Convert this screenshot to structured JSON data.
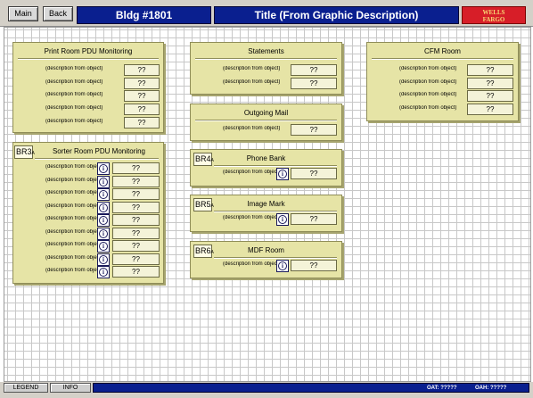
{
  "header": {
    "main_label": "Main",
    "back_label": "Back",
    "building": "Bldg #1801",
    "title": "Title (From Graphic Description)",
    "logo_line1": "WELLS",
    "logo_line2": "FARGO"
  },
  "panels": {
    "print_room": {
      "title": "Print Room PDU Monitoring",
      "rows": [
        {
          "desc": "(description from object)",
          "value": "??"
        },
        {
          "desc": "(description from object)",
          "value": "??"
        },
        {
          "desc": "(description from object)",
          "value": "??"
        },
        {
          "desc": "(description from object)",
          "value": "??"
        },
        {
          "desc": "(description from object)",
          "value": "??"
        }
      ]
    },
    "sorter_room": {
      "tag": "BR3",
      "tag_sub": "A",
      "title": "Sorter Room PDU Monitoring",
      "rows": [
        {
          "desc": "(description from object)",
          "value": "??"
        },
        {
          "desc": "(description from object)",
          "value": "??"
        },
        {
          "desc": "(description from object)",
          "value": "??"
        },
        {
          "desc": "(description from object)",
          "value": "??"
        },
        {
          "desc": "(description from object)",
          "value": "??"
        },
        {
          "desc": "(description from object)",
          "value": "??"
        },
        {
          "desc": "(description from object)",
          "value": "??"
        },
        {
          "desc": "(description from object)",
          "value": "??"
        },
        {
          "desc": "(description from object)",
          "value": "??"
        }
      ]
    },
    "statements": {
      "title": "Statements",
      "rows": [
        {
          "desc": "(description from object)",
          "value": "??"
        },
        {
          "desc": "(description from object)",
          "value": "??"
        }
      ]
    },
    "outgoing_mail": {
      "title": "Outgoing Mail",
      "rows": [
        {
          "desc": "(description from object)",
          "value": "??"
        }
      ]
    },
    "phone_bank": {
      "tag": "BR4",
      "tag_sub": "A",
      "title": "Phone Bank",
      "rows": [
        {
          "desc": "(description from object)",
          "value": "??"
        }
      ]
    },
    "image_mark": {
      "tag": "BR5",
      "tag_sub": "A",
      "title": "Image Mark",
      "rows": [
        {
          "desc": "(description from object)",
          "value": "??"
        }
      ]
    },
    "mdf_room": {
      "tag": "BR6",
      "tag_sub": "A",
      "title": "MDF Room",
      "rows": [
        {
          "desc": "(description from object)",
          "value": "??"
        }
      ]
    },
    "cfm_room": {
      "title": "CFM Room",
      "rows": [
        {
          "desc": "(description from object)",
          "value": "??"
        },
        {
          "desc": "(description from object)",
          "value": "??"
        },
        {
          "desc": "(description from object)",
          "value": "??"
        },
        {
          "desc": "(description from object)",
          "value": "??"
        }
      ]
    }
  },
  "footer": {
    "legend_label": "LEGEND",
    "info_label": "INFO",
    "oat": "OAT: ?????",
    "oah": "OAH: ?????"
  },
  "colors": {
    "header_bar": "#0a1f8f",
    "panel_fill": "#e6e4a6",
    "logo_red": "#d71e28"
  },
  "icons": {
    "info": "info-circle-icon"
  }
}
